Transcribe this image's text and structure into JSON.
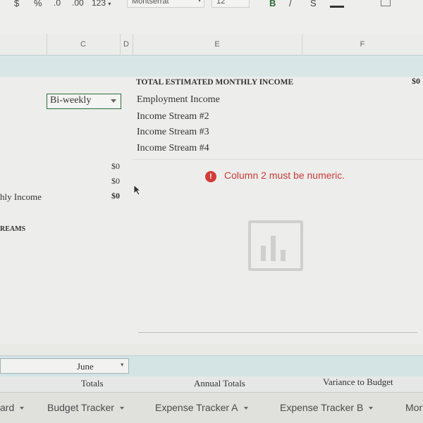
{
  "toolbar": {
    "currency": "$",
    "percent": "%",
    "decrease_decimals": ".0",
    "increase_decimals": ".00",
    "number_format": "123",
    "font": "Montserrat",
    "font_size": "12",
    "bold": "B"
  },
  "columns": [
    "C",
    "D",
    "E",
    "F"
  ],
  "sheet": {
    "pay_frequency": "Bi-weekly",
    "income_header": "TOTAL ESTIMATED MONTHLY INCOME",
    "income_header_value": "$0",
    "income_streams": [
      "Employment Income",
      "Income Stream #2",
      "Income Stream #3",
      "Income Stream #4"
    ],
    "values": [
      "$0",
      "$0"
    ],
    "monthly_income_label": "hly Income",
    "monthly_income_value": "$0",
    "section_label": "REAMS",
    "error_message": "Column 2 must be numeric.",
    "month_select": "June",
    "totals_headers": [
      "Totals",
      "Annual Totals",
      "Variance to Budget"
    ]
  },
  "tabs": [
    "ard",
    "Budget Tracker",
    "Expense Tracker A",
    "Expense Tracker B",
    "Mor"
  ],
  "colors": {
    "accent_green": "#2f6b3b",
    "error_red": "#d33a3a",
    "header_teal": "#d9e6e7"
  }
}
